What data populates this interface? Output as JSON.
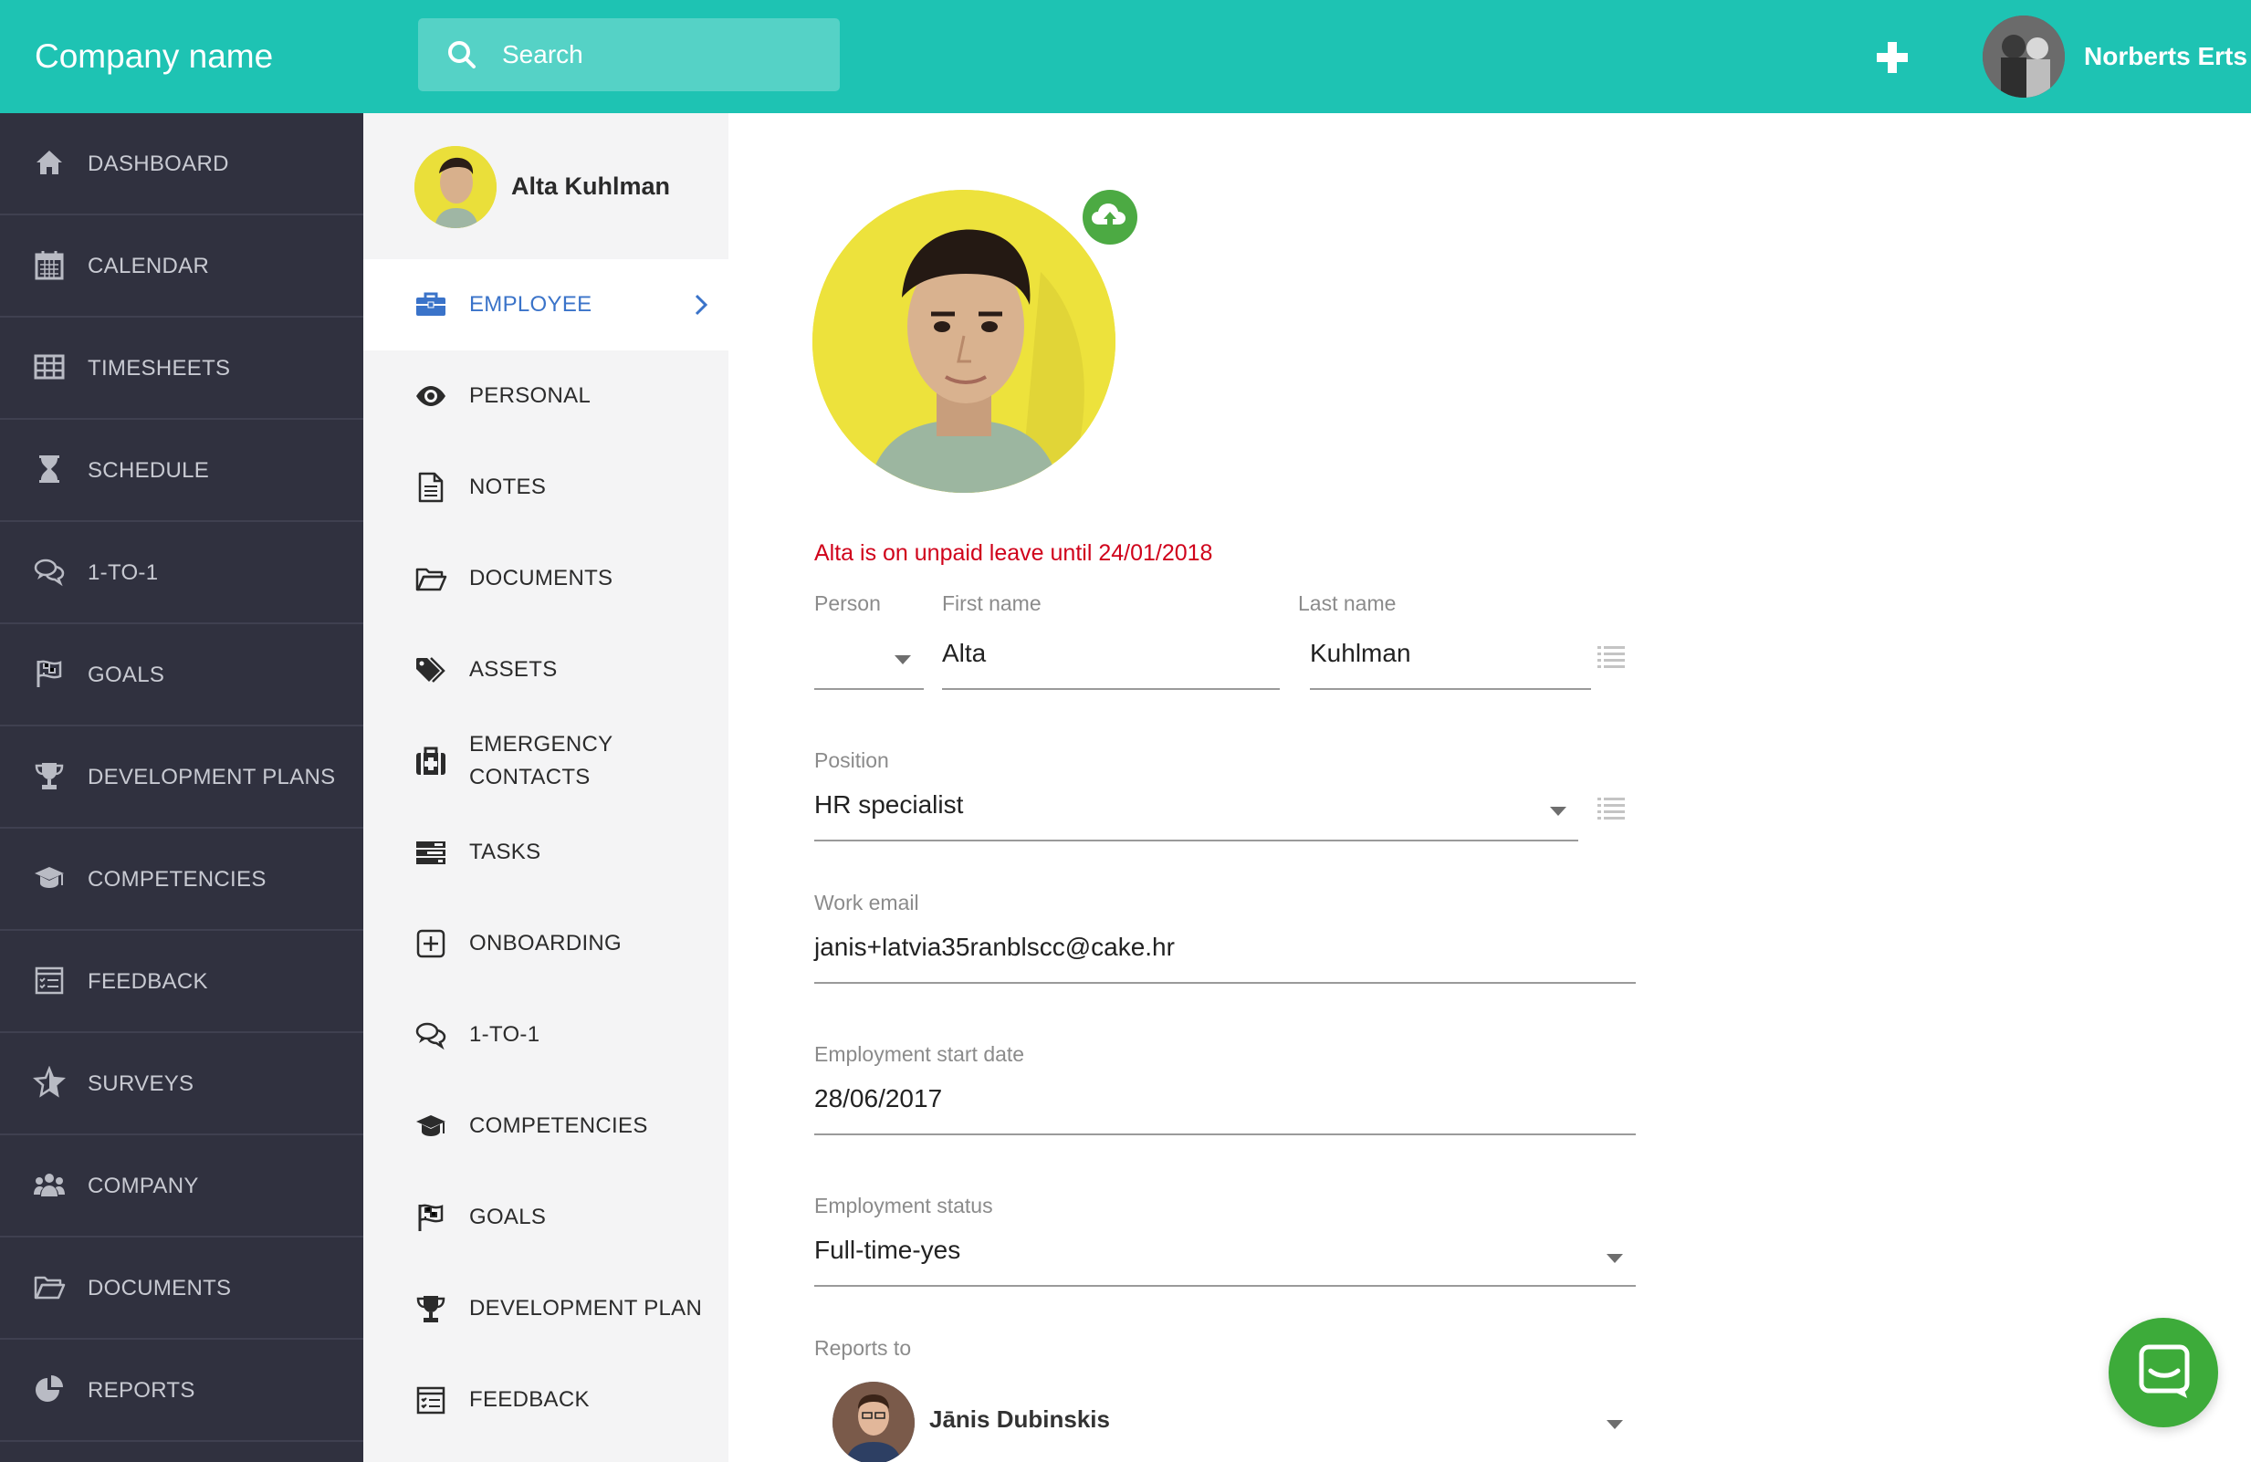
{
  "app": {
    "company_name": "Company name"
  },
  "search": {
    "placeholder": "Search"
  },
  "user": {
    "name": "Norberts Erts"
  },
  "sidebar": {
    "items": [
      {
        "label": "DASHBOARD",
        "icon": "home-icon"
      },
      {
        "label": "CALENDAR",
        "icon": "calendar-icon"
      },
      {
        "label": "TIMESHEETS",
        "icon": "table-icon"
      },
      {
        "label": "SCHEDULE",
        "icon": "hourglass-icon"
      },
      {
        "label": "1-TO-1",
        "icon": "chat-bubbles-icon"
      },
      {
        "label": "GOALS",
        "icon": "flag-icon"
      },
      {
        "label": "DEVELOPMENT PLANS",
        "icon": "trophy-icon"
      },
      {
        "label": "COMPETENCIES",
        "icon": "graduation-cap-icon"
      },
      {
        "label": "FEEDBACK",
        "icon": "checklist-icon"
      },
      {
        "label": "SURVEYS",
        "icon": "star-icon"
      },
      {
        "label": "COMPANY",
        "icon": "users-icon"
      },
      {
        "label": "DOCUMENTS",
        "icon": "folder-icon"
      },
      {
        "label": "REPORTS",
        "icon": "pie-chart-icon"
      }
    ]
  },
  "employee": {
    "name": "Alta Kuhlman",
    "leave_notice": "Alta is on unpaid leave until 24/01/2018"
  },
  "subnav": {
    "items": [
      {
        "label": "EMPLOYEE",
        "icon": "briefcase-icon",
        "active": true
      },
      {
        "label": "PERSONAL",
        "icon": "eye-icon"
      },
      {
        "label": "NOTES",
        "icon": "note-icon"
      },
      {
        "label": "DOCUMENTS",
        "icon": "folder-icon"
      },
      {
        "label": "ASSETS",
        "icon": "tags-icon"
      },
      {
        "label": "EMERGENCY",
        "label2": "CONTACTS",
        "icon": "medkit-icon"
      },
      {
        "label": "TASKS",
        "icon": "tasks-icon"
      },
      {
        "label": "ONBOARDING",
        "icon": "plus-square-icon"
      },
      {
        "label": "1-TO-1",
        "icon": "chat-bubbles-icon"
      },
      {
        "label": "COMPETENCIES",
        "icon": "graduation-cap-icon"
      },
      {
        "label": "GOALS",
        "icon": "flag-icon"
      },
      {
        "label": "DEVELOPMENT PLAN",
        "icon": "trophy-icon"
      },
      {
        "label": "FEEDBACK",
        "icon": "checklist-icon"
      }
    ]
  },
  "form": {
    "person_label": "Person",
    "person_value": "",
    "first_name_label": "First name",
    "first_name": "Alta",
    "last_name_label": "Last name",
    "last_name": "Kuhlman",
    "position_label": "Position",
    "position": "HR specialist",
    "work_email_label": "Work email",
    "work_email": "janis+latvia35ranblscc@cake.hr",
    "start_date_label": "Employment start date",
    "start_date": "28/06/2017",
    "status_label": "Employment status",
    "status": "Full-time-yes",
    "reports_to_label": "Reports to",
    "reports_to": "Jānis Dubinskis"
  },
  "colors": {
    "brand": "#1ec3b3",
    "sidebar": "#30313f",
    "active_link": "#3a73c9",
    "warning": "#d0021b",
    "upload": "#4caa43"
  }
}
